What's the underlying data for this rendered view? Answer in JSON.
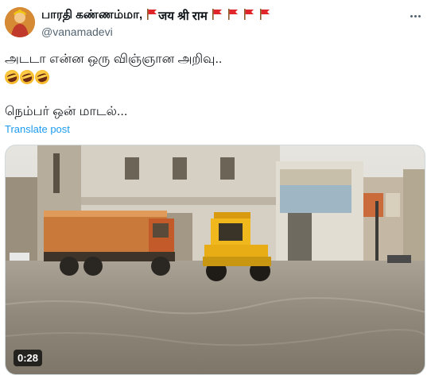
{
  "author": {
    "name": "பாரதி கண்ணம்மா,",
    "tag": "जय श्री राम",
    "handle": "@vanamadevi"
  },
  "post": {
    "line1": "அடடா என்ன ஒரு விஞ்ஞான அறிவு..",
    "emojis": [
      "rofl-emoji",
      "rofl-emoji",
      "rofl-emoji"
    ],
    "line3": "நெம்பர் ஒன் மாடல்...",
    "translate_label": "Translate post"
  },
  "media": {
    "duration": "0:28"
  },
  "colors": {
    "link": "#1d9bf0",
    "muted": "#536471",
    "flag": "#e0262a"
  }
}
